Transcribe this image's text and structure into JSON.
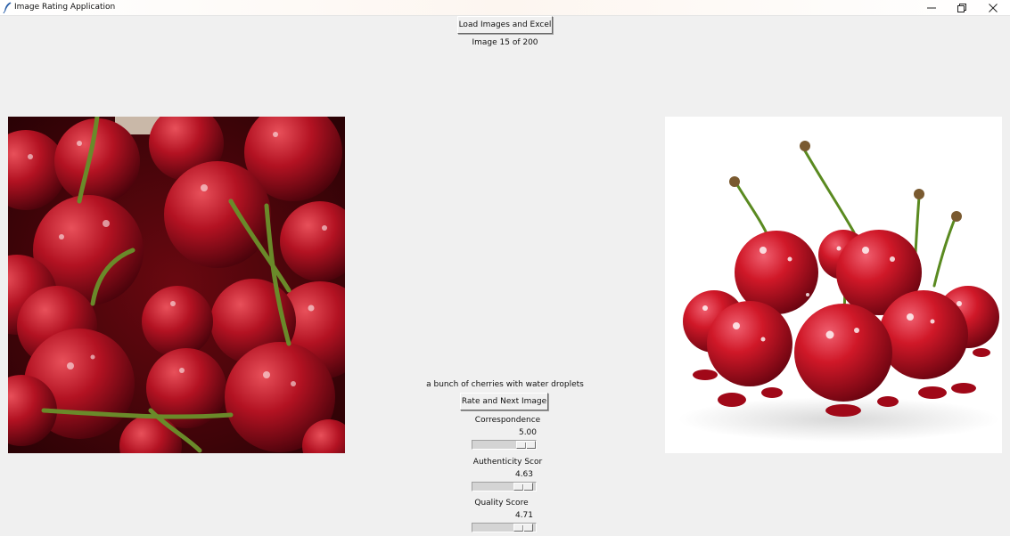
{
  "window": {
    "title": "Image Rating Application"
  },
  "toolbar": {
    "load_label": "Load Images and Excel"
  },
  "status": {
    "progress_text": "Image 15 of 200"
  },
  "images": {
    "left": {
      "subject": "cherries"
    },
    "right": {
      "subject": "cherries"
    }
  },
  "caption": {
    "text": "a bunch of cherries with water droplets"
  },
  "actions": {
    "rate_next_label": "Rate and Next Image"
  },
  "ratings": [
    {
      "label": "Correspondence",
      "value_text": "5.00",
      "fraction": 1.0
    },
    {
      "label": "Authenticity Scor",
      "value_text": "4.63",
      "fraction": 0.93
    },
    {
      "label": "Quality Score",
      "value_text": "4.71",
      "fraction": 0.94
    }
  ],
  "icons": {
    "app": "feather-icon",
    "minimize": "minimize-icon",
    "maximize": "restore-icon",
    "close": "close-icon"
  },
  "colors": {
    "window_bg": "#f0f0f0",
    "cherry_red": "#c0101c"
  }
}
